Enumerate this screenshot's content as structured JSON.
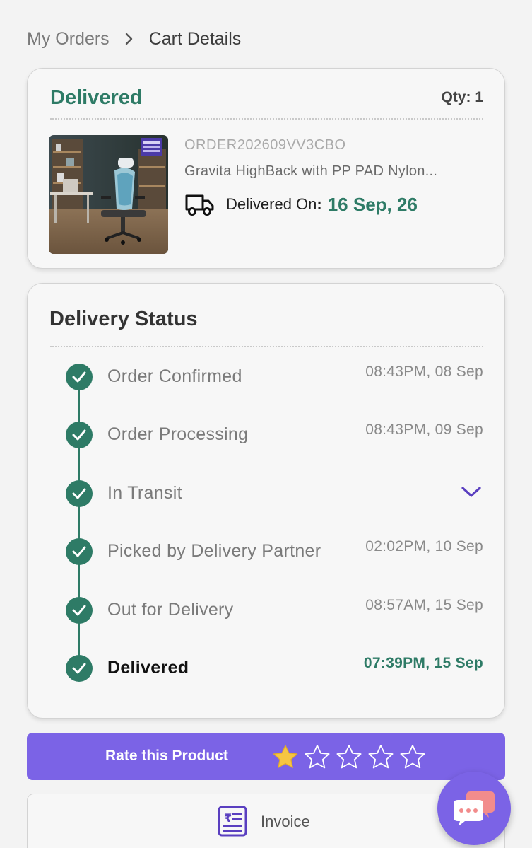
{
  "breadcrumb": {
    "parent": "My Orders",
    "separator_icon": "chevron-right-icon",
    "current": "Cart Details"
  },
  "order": {
    "status": "Delivered",
    "qty": "Qty: 1",
    "order_id": "ORDER202609VV3CBO",
    "product_name": "Gravita HighBack with PP PAD Nylon...",
    "delivered_on_label": "Delivered On",
    "delivered_on_colon": ":",
    "delivered_on_date": "16 Sep, 26",
    "thumb_badge_text": "100 Days FREE Trial"
  },
  "delivery_status": {
    "title": "Delivery Status",
    "steps": [
      {
        "label": "Order Confirmed",
        "time": "08:43PM, 08 Sep"
      },
      {
        "label": "Order Processing",
        "time": "08:43PM, 09 Sep"
      },
      {
        "label": "In Transit",
        "time": "",
        "expand_icon": "chevron-down-icon"
      },
      {
        "label": "Picked by Delivery Partner",
        "time": "02:02PM, 10 Sep"
      },
      {
        "label": "Out for Delivery",
        "time": "08:57AM, 15 Sep"
      },
      {
        "label": "Delivered",
        "time": "07:39PM, 15 Sep"
      }
    ]
  },
  "rating": {
    "label": "Rate this Product",
    "value": 1,
    "max": 5
  },
  "invoice": {
    "label": "Invoice"
  },
  "colors": {
    "accent_green": "#2e7b66",
    "accent_purple": "#7b63e6",
    "star_gold": "#f5c542"
  }
}
